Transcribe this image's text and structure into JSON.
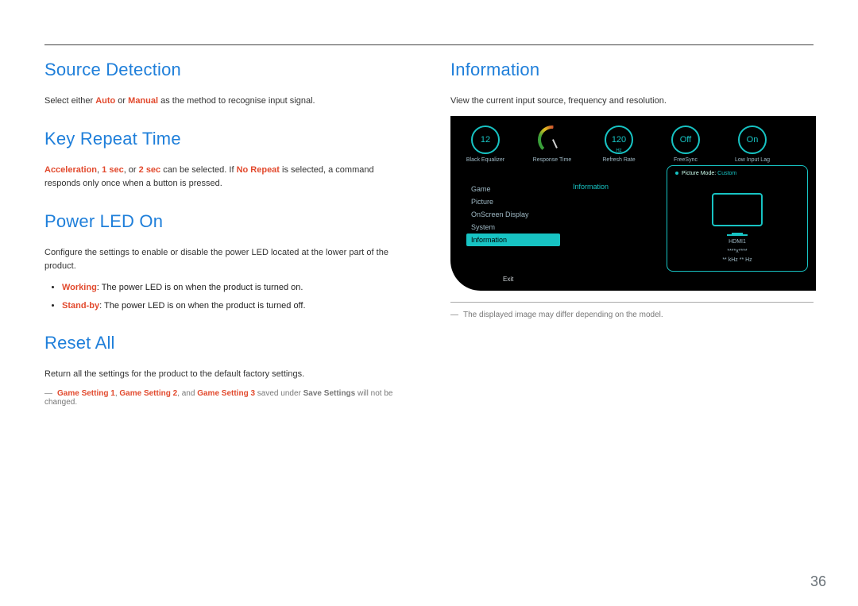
{
  "page_number": "36",
  "left": {
    "source_detection": {
      "heading": "Source Detection",
      "body_pre": "Select either ",
      "kw_auto": "Auto",
      "body_mid": " or ",
      "kw_manual": "Manual",
      "body_post": " as the method to recognise input signal."
    },
    "key_repeat_time": {
      "heading": "Key Repeat Time",
      "kw_accel": "Acceleration",
      "sep1": ", ",
      "kw_1sec": "1 sec",
      "sep2": ", or ",
      "kw_2sec": "2 sec",
      "mid1": " can be selected. If ",
      "kw_norepeat": "No Repeat",
      "post": " is selected, a command responds only once when a button is pressed."
    },
    "power_led_on": {
      "heading": "Power LED On",
      "body": "Configure the settings to enable or disable the power LED located at the lower part of the product.",
      "item_working_kw": "Working",
      "item_working_txt": ": The power LED is on when the product is turned on.",
      "item_standby_kw": "Stand-by",
      "item_standby_txt": ": The power LED is on when the product is turned off."
    },
    "reset_all": {
      "heading": "Reset All",
      "body": "Return all the settings for the product to the default factory settings.",
      "fn_dash": "―",
      "fn_g1": "Game Setting 1",
      "fn_sep1": ", ",
      "fn_g2": "Game Setting 2",
      "fn_mid": ", and ",
      "fn_g3": "Game Setting 3",
      "fn_post1": " saved under ",
      "fn_save": "Save Settings",
      "fn_post2": " will not be changed."
    }
  },
  "right": {
    "information": {
      "heading": "Information",
      "body": "View the current input source, frequency and resolution."
    },
    "footnote": {
      "dash": "―",
      "text": "The displayed image may differ depending on the model."
    }
  },
  "osd": {
    "dials": [
      {
        "value": "12",
        "label": "Black Equalizer",
        "sub": ""
      },
      {
        "value": "",
        "label": "Response Time",
        "sub": "",
        "gauge": true
      },
      {
        "value": "120",
        "label": "Refresh Rate",
        "sub": "Hz"
      },
      {
        "value": "Off",
        "label": "FreeSync",
        "sub": ""
      },
      {
        "value": "On",
        "label": "Low Input Lag",
        "sub": ""
      }
    ],
    "menu_title": "Information",
    "menu": [
      {
        "label": "Game",
        "selected": false
      },
      {
        "label": "Picture",
        "selected": false
      },
      {
        "label": "OnScreen Display",
        "selected": false
      },
      {
        "label": "System",
        "selected": false
      },
      {
        "label": "Information",
        "selected": true
      }
    ],
    "exit": "Exit",
    "panel": {
      "picture_mode_label": "Picture Mode: ",
      "picture_mode_value": "Custom",
      "source": "HDMI1",
      "resolution": "****x****",
      "freq": "** kHz  ** Hz"
    }
  }
}
